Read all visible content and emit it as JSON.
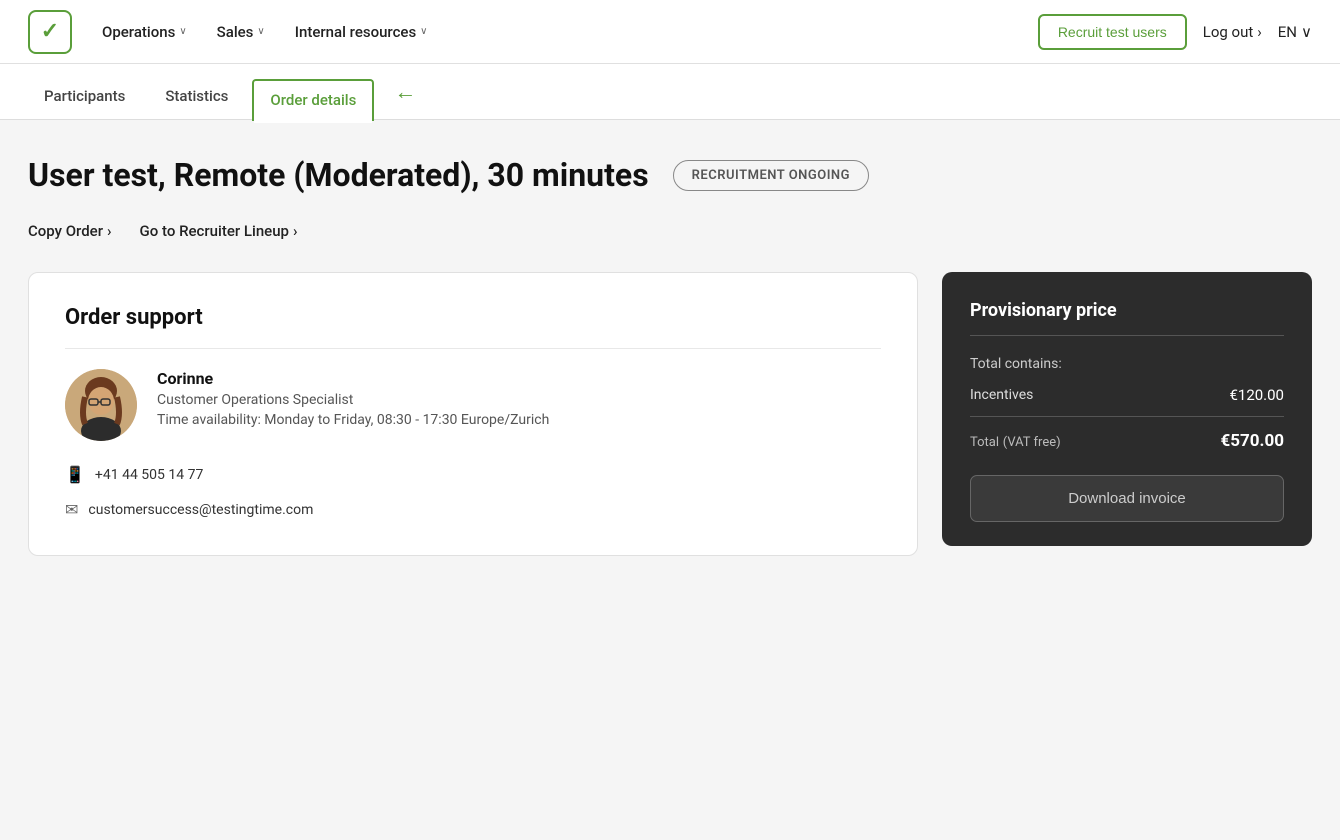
{
  "nav": {
    "logo_check": "✓",
    "items": [
      {
        "label": "Operations",
        "id": "operations"
      },
      {
        "label": "Sales",
        "id": "sales"
      },
      {
        "label": "Internal resources",
        "id": "internal-resources"
      }
    ],
    "recruit_button": "Recruit test users",
    "logout_label": "Log out",
    "logout_chevron": "›",
    "lang_label": "EN",
    "lang_chevron": "∨"
  },
  "tabs": [
    {
      "label": "Participants",
      "active": false
    },
    {
      "label": "Statistics",
      "active": false
    },
    {
      "label": "Order details",
      "active": true
    }
  ],
  "page": {
    "title": "User test, Remote (Moderated), 30 minutes",
    "status_badge": "RECRUITMENT ONGOING",
    "copy_order": "Copy Order",
    "copy_order_chevron": "›",
    "go_to_recruiter": "Go to Recruiter Lineup",
    "go_to_recruiter_chevron": "›"
  },
  "order_support": {
    "card_title": "Order support",
    "person": {
      "name": "Corinne",
      "role": "Customer Operations Specialist",
      "availability": "Time availability: Monday to Friday, 08:30 - 17:30 Europe/Zurich"
    },
    "phone": "+41 44 505 14 77",
    "email": "customersuccess@testingtime.com"
  },
  "price": {
    "card_title": "Provisionary price",
    "total_contains_label": "Total contains:",
    "incentives_label": "Incentives",
    "incentives_value": "€120.00",
    "total_label": "Total",
    "total_vat_label": "(VAT free)",
    "total_value": "€570.00",
    "download_button": "Download invoice"
  }
}
